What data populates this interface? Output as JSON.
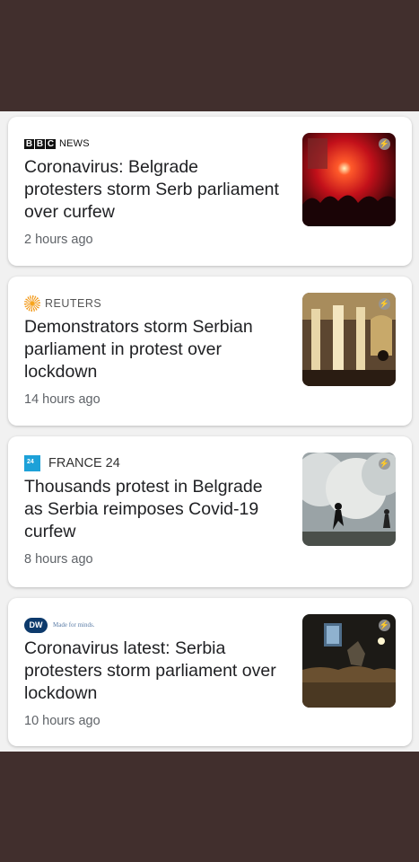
{
  "articles": [
    {
      "source": {
        "parts": [
          "B",
          "B",
          "C"
        ],
        "suffix": "NEWS",
        "icon": "bbc-news-logo"
      },
      "headline": "Coronavirus: Belgrade protesters storm Serb parliament over curfew",
      "time": "2 hours ago",
      "thumbnail": "crowd-with-flare-image"
    },
    {
      "source": {
        "name": "REUTERS",
        "icon": "reuters-logo"
      },
      "headline": "Demonstrators storm Serbian parliament in protest over lockdown",
      "time": "14 hours ago",
      "thumbnail": "parliament-building-image"
    },
    {
      "source": {
        "name": "FRANCE 24",
        "icon": "france24-logo"
      },
      "headline": "Thousands protest in Belgrade as Serbia reimposes Covid-19 curfew",
      "time": "8 hours ago",
      "thumbnail": "tear-gas-protest-image"
    },
    {
      "source": {
        "mark": "DW",
        "tagline": "Made for minds.",
        "icon": "dw-logo"
      },
      "headline": "Coronavirus latest: Serbia protesters storm parliament over lockdown",
      "time": "10 hours ago",
      "thumbnail": "night-crowd-image"
    }
  ],
  "colors": {
    "background": "#412f2d",
    "feed": "#f1f1f1",
    "headline": "#202124",
    "meta": "#5f6368"
  }
}
